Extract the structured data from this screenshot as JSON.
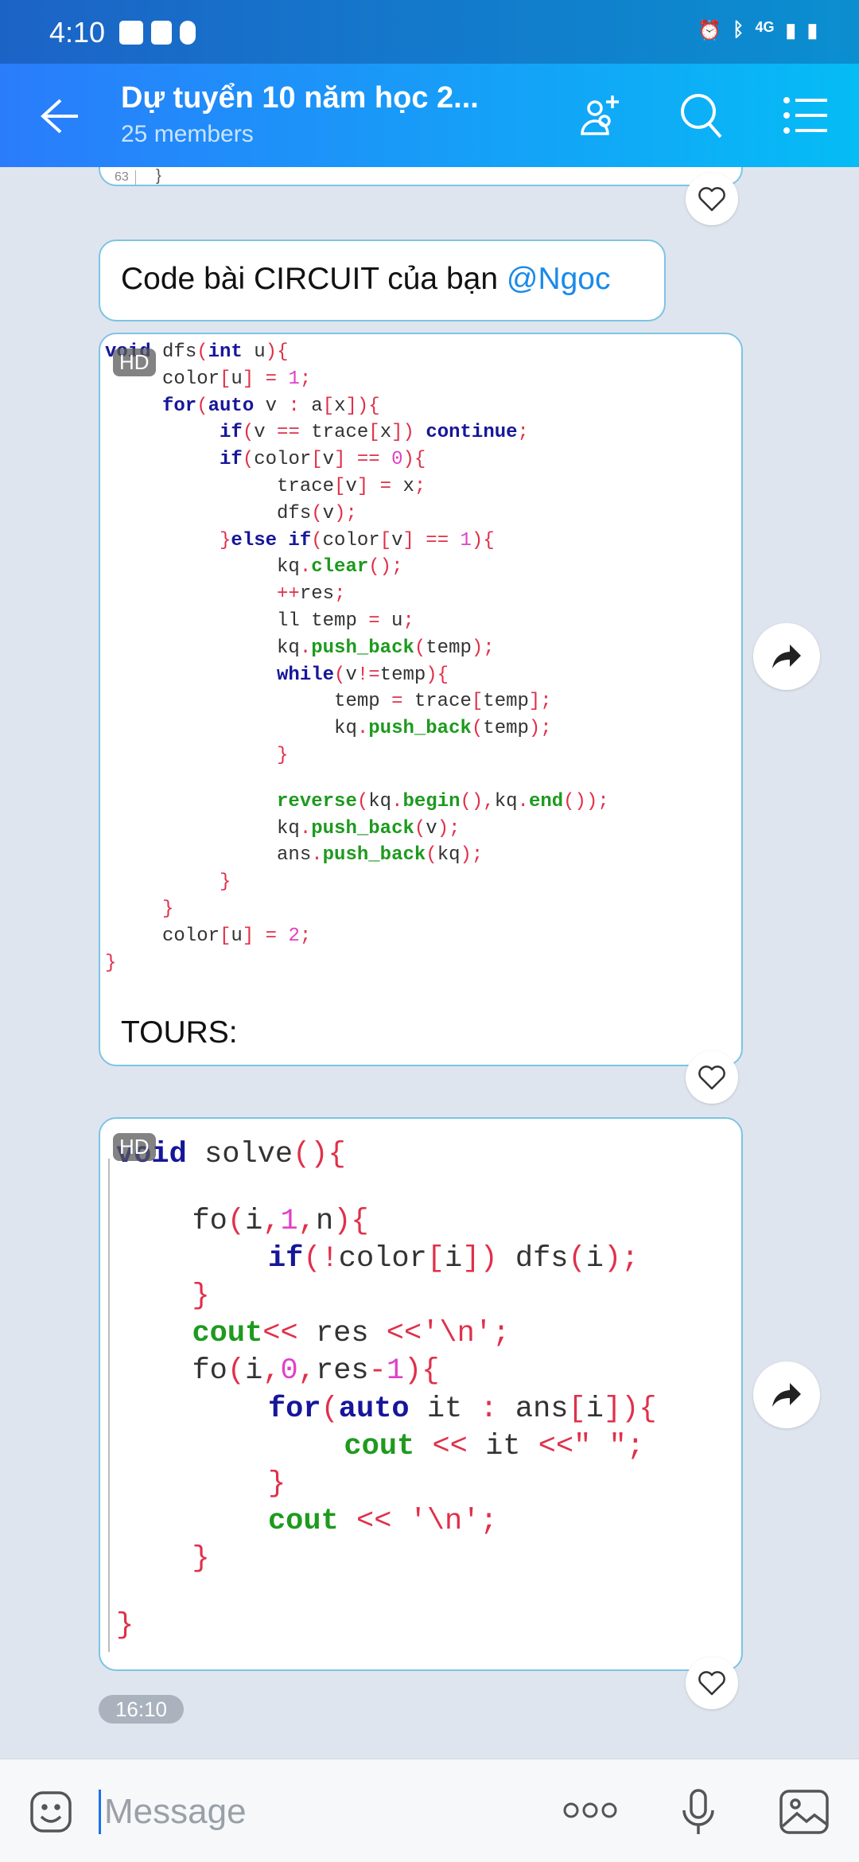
{
  "status": {
    "time": "4:10",
    "network": "4G"
  },
  "header": {
    "title": "Dự tuyển 10 năm học 2...",
    "subtitle": "25 members"
  },
  "prev": {
    "line_no": "63",
    "code": "}"
  },
  "messages": {
    "text": {
      "prefix": "Code bài CIRCUIT của bạn ",
      "mention": "@Ngoc"
    },
    "image1": {
      "badge": "HD",
      "caption": "TOURS:",
      "lines": [
        {
          "indent": 0,
          "t": [
            [
              "k",
              "void"
            ],
            [
              "i",
              " dfs"
            ],
            [
              "p",
              "("
            ],
            [
              "k",
              "int"
            ],
            [
              "i",
              " u"
            ],
            [
              "p",
              ")"
            ],
            [
              "p",
              "{"
            ]
          ]
        },
        {
          "indent": 1,
          "t": [
            [
              "i",
              "color"
            ],
            [
              "p",
              "["
            ],
            [
              "i",
              "u"
            ],
            [
              "p",
              "]"
            ],
            [
              "i",
              " "
            ],
            [
              "p",
              "="
            ],
            [
              "i",
              " "
            ],
            [
              "n",
              "1"
            ],
            [
              "p",
              ";"
            ]
          ]
        },
        {
          "indent": 1,
          "t": [
            [
              "k",
              "for"
            ],
            [
              "p",
              "("
            ],
            [
              "k",
              "auto"
            ],
            [
              "i",
              " v "
            ],
            [
              "p",
              ":"
            ],
            [
              "i",
              " a"
            ],
            [
              "p",
              "["
            ],
            [
              "i",
              "x"
            ],
            [
              "p",
              "])"
            ],
            [
              "p",
              "{"
            ]
          ]
        },
        {
          "indent": 2,
          "t": [
            [
              "k",
              "if"
            ],
            [
              "p",
              "("
            ],
            [
              "i",
              "v "
            ],
            [
              "p",
              "=="
            ],
            [
              "i",
              " trace"
            ],
            [
              "p",
              "["
            ],
            [
              "i",
              "x"
            ],
            [
              "p",
              "])"
            ],
            [
              "i",
              " "
            ],
            [
              "k",
              "continue"
            ],
            [
              "p",
              ";"
            ]
          ]
        },
        {
          "indent": 2,
          "t": [
            [
              "k",
              "if"
            ],
            [
              "p",
              "("
            ],
            [
              "i",
              "color"
            ],
            [
              "p",
              "["
            ],
            [
              "i",
              "v"
            ],
            [
              "p",
              "]"
            ],
            [
              "i",
              " "
            ],
            [
              "p",
              "=="
            ],
            [
              "i",
              " "
            ],
            [
              "n",
              "0"
            ],
            [
              "p",
              "){"
            ]
          ]
        },
        {
          "indent": 3,
          "t": [
            [
              "i",
              "trace"
            ],
            [
              "p",
              "["
            ],
            [
              "i",
              "v"
            ],
            [
              "p",
              "]"
            ],
            [
              "i",
              " "
            ],
            [
              "p",
              "="
            ],
            [
              "i",
              " x"
            ],
            [
              "p",
              ";"
            ]
          ]
        },
        {
          "indent": 3,
          "t": [
            [
              "i",
              "dfs"
            ],
            [
              "p",
              "("
            ],
            [
              "i",
              "v"
            ],
            [
              "p",
              ");"
            ]
          ]
        },
        {
          "indent": 2,
          "t": [
            [
              "p",
              "}"
            ],
            [
              "k",
              "else if"
            ],
            [
              "p",
              "("
            ],
            [
              "i",
              "color"
            ],
            [
              "p",
              "["
            ],
            [
              "i",
              "v"
            ],
            [
              "p",
              "]"
            ],
            [
              "i",
              " "
            ],
            [
              "p",
              "=="
            ],
            [
              "i",
              " "
            ],
            [
              "n",
              "1"
            ],
            [
              "p",
              "){"
            ]
          ]
        },
        {
          "indent": 3,
          "t": [
            [
              "i",
              "kq"
            ],
            [
              "p",
              "."
            ],
            [
              "f",
              "clear"
            ],
            [
              "p",
              "();"
            ]
          ]
        },
        {
          "indent": 3,
          "t": [
            [
              "p",
              "++"
            ],
            [
              "i",
              "res"
            ],
            [
              "p",
              ";"
            ]
          ]
        },
        {
          "indent": 3,
          "t": [
            [
              "i",
              "ll temp "
            ],
            [
              "p",
              "="
            ],
            [
              "i",
              " u"
            ],
            [
              "p",
              ";"
            ]
          ]
        },
        {
          "indent": 3,
          "t": [
            [
              "i",
              "kq"
            ],
            [
              "p",
              "."
            ],
            [
              "f",
              "push_back"
            ],
            [
              "p",
              "("
            ],
            [
              "i",
              "temp"
            ],
            [
              "p",
              ");"
            ]
          ]
        },
        {
          "indent": 3,
          "t": [
            [
              "k",
              "while"
            ],
            [
              "p",
              "("
            ],
            [
              "i",
              "v"
            ],
            [
              "p",
              "!="
            ],
            [
              "i",
              "temp"
            ],
            [
              "p",
              "){"
            ]
          ]
        },
        {
          "indent": 4,
          "t": [
            [
              "i",
              "temp "
            ],
            [
              "p",
              "="
            ],
            [
              "i",
              " trace"
            ],
            [
              "p",
              "["
            ],
            [
              "i",
              "temp"
            ],
            [
              "p",
              "];"
            ]
          ]
        },
        {
          "indent": 4,
          "t": [
            [
              "i",
              "kq"
            ],
            [
              "p",
              "."
            ],
            [
              "f",
              "push_back"
            ],
            [
              "p",
              "("
            ],
            [
              "i",
              "temp"
            ],
            [
              "p",
              ");"
            ]
          ]
        },
        {
          "indent": 3,
          "t": [
            [
              "p",
              "}"
            ]
          ]
        },
        {
          "indent": 0,
          "t": []
        },
        {
          "indent": 3,
          "t": [
            [
              "f",
              "reverse"
            ],
            [
              "p",
              "("
            ],
            [
              "i",
              "kq"
            ],
            [
              "p",
              "."
            ],
            [
              "f",
              "begin"
            ],
            [
              "p",
              "(),"
            ],
            [
              "i",
              "kq"
            ],
            [
              "p",
              "."
            ],
            [
              "f",
              "end"
            ],
            [
              "p",
              "());"
            ]
          ]
        },
        {
          "indent": 3,
          "t": [
            [
              "i",
              "kq"
            ],
            [
              "p",
              "."
            ],
            [
              "f",
              "push_back"
            ],
            [
              "p",
              "("
            ],
            [
              "i",
              "v"
            ],
            [
              "p",
              ");"
            ]
          ]
        },
        {
          "indent": 3,
          "t": [
            [
              "i",
              "ans"
            ],
            [
              "p",
              "."
            ],
            [
              "f",
              "push_back"
            ],
            [
              "p",
              "("
            ],
            [
              "i",
              "kq"
            ],
            [
              "p",
              ");"
            ]
          ]
        },
        {
          "indent": 2,
          "t": [
            [
              "p",
              "}"
            ]
          ]
        },
        {
          "indent": 1,
          "t": [
            [
              "p",
              "}"
            ]
          ]
        },
        {
          "indent": 1,
          "t": [
            [
              "i",
              "color"
            ],
            [
              "p",
              "["
            ],
            [
              "i",
              "u"
            ],
            [
              "p",
              "]"
            ],
            [
              "i",
              " "
            ],
            [
              "p",
              "="
            ],
            [
              "i",
              " "
            ],
            [
              "n",
              "2"
            ],
            [
              "p",
              ";"
            ]
          ]
        },
        {
          "indent": 0,
          "t": [
            [
              "p",
              "}"
            ]
          ]
        }
      ]
    },
    "image2": {
      "badge": "HD",
      "lines": [
        {
          "indent": 0,
          "t": [
            [
              "k",
              "void"
            ],
            [
              "i",
              " solve"
            ],
            [
              "p",
              "(){"
            ]
          ]
        },
        {
          "indent": 0,
          "t": []
        },
        {
          "indent": 1,
          "t": [
            [
              "i",
              "fo"
            ],
            [
              "p",
              "("
            ],
            [
              "i",
              "i"
            ],
            [
              "p",
              ","
            ],
            [
              "n",
              "1"
            ],
            [
              "p",
              ","
            ],
            [
              "i",
              "n"
            ],
            [
              "p",
              "){"
            ]
          ]
        },
        {
          "indent": 2,
          "t": [
            [
              "k",
              "if"
            ],
            [
              "p",
              "(!"
            ],
            [
              "i",
              "color"
            ],
            [
              "p",
              "["
            ],
            [
              "i",
              "i"
            ],
            [
              "p",
              "])"
            ],
            [
              "i",
              " dfs"
            ],
            [
              "p",
              "("
            ],
            [
              "i",
              "i"
            ],
            [
              "p",
              ");"
            ]
          ]
        },
        {
          "indent": 1,
          "t": [
            [
              "p",
              "}"
            ]
          ]
        },
        {
          "indent": 1,
          "t": [
            [
              "f",
              "cout"
            ],
            [
              "p",
              "<<"
            ],
            [
              "i",
              " res "
            ],
            [
              "p",
              "<<"
            ],
            [
              "s",
              "'\\n'"
            ],
            [
              "p",
              ";"
            ]
          ]
        },
        {
          "indent": 1,
          "t": [
            [
              "i",
              "fo"
            ],
            [
              "p",
              "("
            ],
            [
              "i",
              "i"
            ],
            [
              "p",
              ","
            ],
            [
              "n",
              "0"
            ],
            [
              "p",
              ","
            ],
            [
              "i",
              "res"
            ],
            [
              "p",
              "-"
            ],
            [
              "n",
              "1"
            ],
            [
              "p",
              "){"
            ]
          ]
        },
        {
          "indent": 2,
          "t": [
            [
              "k",
              "for"
            ],
            [
              "p",
              "("
            ],
            [
              "k",
              "auto"
            ],
            [
              "i",
              " it "
            ],
            [
              "p",
              ":"
            ],
            [
              "i",
              " ans"
            ],
            [
              "p",
              "["
            ],
            [
              "i",
              "i"
            ],
            [
              "p",
              "]){"
            ]
          ]
        },
        {
          "indent": 3,
          "t": [
            [
              "f",
              "cout"
            ],
            [
              "i",
              " "
            ],
            [
              "p",
              "<<"
            ],
            [
              "i",
              " it "
            ],
            [
              "p",
              "<<"
            ],
            [
              "s",
              "\" \""
            ],
            [
              "p",
              ";"
            ]
          ]
        },
        {
          "indent": 2,
          "t": [
            [
              "p",
              "}"
            ]
          ]
        },
        {
          "indent": 2,
          "t": [
            [
              "f",
              "cout"
            ],
            [
              "i",
              " "
            ],
            [
              "p",
              "<<"
            ],
            [
              "i",
              " "
            ],
            [
              "s",
              "'\\n'"
            ],
            [
              "p",
              ";"
            ]
          ]
        },
        {
          "indent": 1,
          "t": [
            [
              "p",
              "}"
            ]
          ]
        },
        {
          "indent": 0,
          "t": []
        },
        {
          "indent": 0,
          "t": [
            [
              "p",
              "}"
            ]
          ]
        }
      ]
    },
    "time": "16:10"
  },
  "composer": {
    "placeholder": "Message"
  },
  "colors": {
    "accent": "#1f8cf5",
    "mention": "#1a8ae8",
    "bubble_border": "#7cc4e4"
  }
}
